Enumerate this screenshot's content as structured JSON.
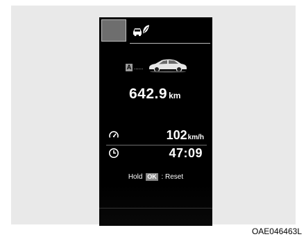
{
  "display": {
    "trip_badge": "A",
    "trip_dots": "......",
    "distance_value": "642.9",
    "distance_unit": "km",
    "speed_value": "102",
    "speed_unit": "km/h",
    "elapsed_time": "47:09",
    "reset_hint": {
      "prefix": "Hold",
      "key": "OK",
      "suffix": ": Reset"
    }
  },
  "icons": {
    "mode": "mode-indicator-box",
    "eco": "eco-car-leaf-icon",
    "car": "car-side-icon",
    "speed": "speedometer-icon",
    "time": "clock-icon"
  },
  "caption": "OAE046463L"
}
